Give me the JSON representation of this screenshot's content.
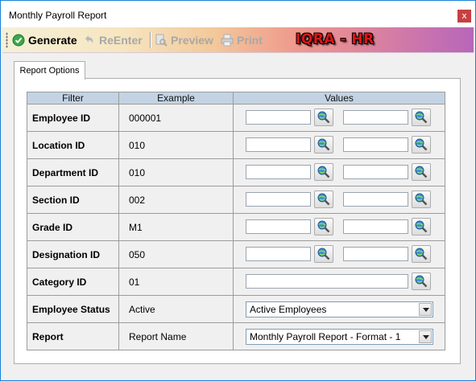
{
  "window": {
    "title": "Monthly Payroll Report",
    "close_glyph": "x"
  },
  "toolbar": {
    "generate": "Generate",
    "reenter": "ReEnter",
    "preview": "Preview",
    "print": "Print",
    "brand": "IQRA - HR"
  },
  "tabs": [
    {
      "label": "Report Options",
      "selected": true
    }
  ],
  "grid": {
    "headers": {
      "filter": "Filter",
      "example": "Example",
      "values": "Values"
    },
    "rows": [
      {
        "label": "Employee ID",
        "example": "000001",
        "from": "",
        "to": ""
      },
      {
        "label": "Location ID",
        "example": "010",
        "from": "",
        "to": ""
      },
      {
        "label": "Department ID",
        "example": "010",
        "from": "",
        "to": ""
      },
      {
        "label": "Section ID",
        "example": "002",
        "from": "",
        "to": ""
      },
      {
        "label": "Grade ID",
        "example": "M1",
        "from": "",
        "to": ""
      },
      {
        "label": "Designation ID",
        "example": "050",
        "from": "",
        "to": ""
      },
      {
        "label": "Category ID",
        "example": "01",
        "value": ""
      },
      {
        "label": "Employee Status",
        "example": "Active",
        "selected": "Active Employees"
      },
      {
        "label": "Report",
        "example": "Report Name",
        "selected": "Monthly Payroll Report - Format - 1"
      }
    ]
  },
  "icons": {
    "generate": "checkmark-circle-icon",
    "reenter": "undo-arrow-icon",
    "preview": "preview-document-icon",
    "print": "printer-icon",
    "lookup": "globe-magnifier-icon"
  },
  "colors": {
    "header_bg": "#c3d3e3",
    "brand_text": "#d81818",
    "title_bar_border": "#1883d7"
  }
}
